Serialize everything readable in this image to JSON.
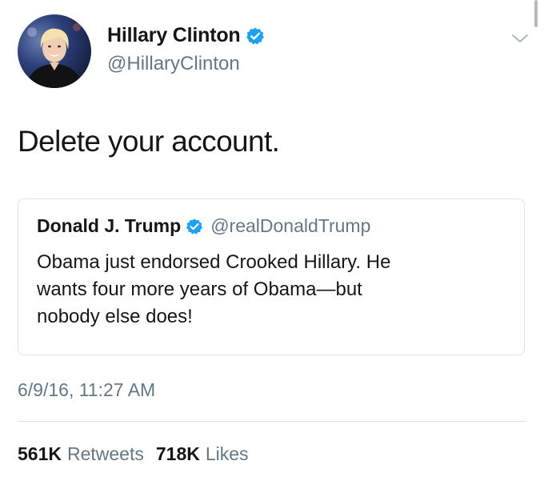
{
  "author": {
    "name": "Hillary Clinton",
    "handle": "@HillaryClinton",
    "verified": true,
    "avatar_icon": "hillary-clinton-avatar"
  },
  "tweet": {
    "text": "Delete your account."
  },
  "quoted_tweet": {
    "name": "Donald J. Trump",
    "handle": "@realDonaldTrump",
    "verified": true,
    "text_lines": [
      "Obama just endorsed Crooked Hillary. He",
      "wants four more years of Obama—but",
      "nobody else does!"
    ]
  },
  "timestamp": "6/9/16, 11:27 AM",
  "stats": {
    "retweets_count": "561K",
    "retweets_label": "Retweets",
    "likes_count": "718K",
    "likes_label": "Likes"
  },
  "icons": {
    "verified": "verified-badge-icon",
    "caret": "chevron-down-icon"
  },
  "colors": {
    "text": "#14171a",
    "secondary_text": "#657786",
    "verified_blue": "#1da1f2",
    "border": "#dfe3e6"
  }
}
